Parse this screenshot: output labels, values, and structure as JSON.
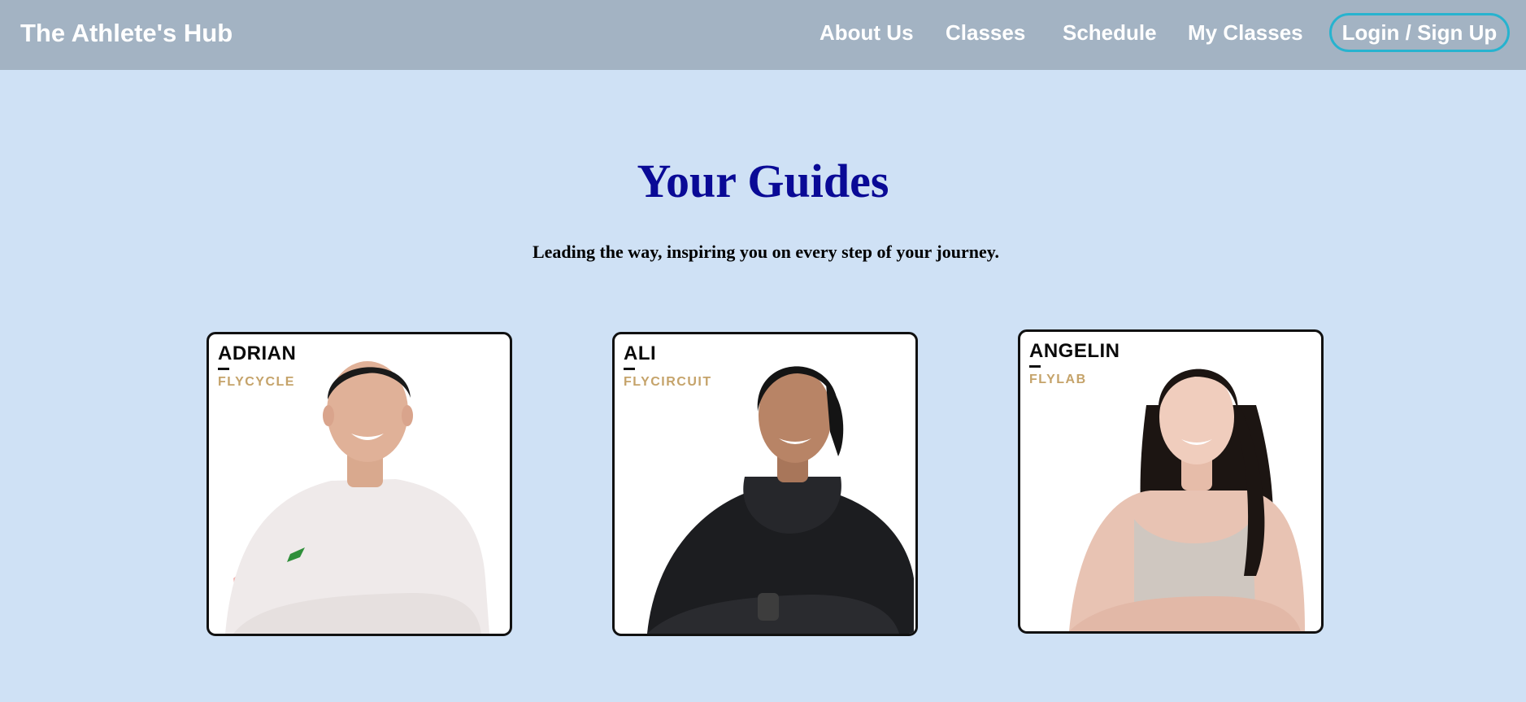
{
  "navbar": {
    "brand": "The Athlete's Hub",
    "links": [
      {
        "label": "About Us"
      },
      {
        "label": "Classes"
      },
      {
        "label": "Schedule"
      },
      {
        "label": "My Classes"
      }
    ],
    "login_label": "Login / Sign Up"
  },
  "hero": {
    "title": "Your Guides",
    "subtitle": "Leading the way, inspiring you on every step of your journey."
  },
  "guides": [
    {
      "name": "ADRIAN",
      "class_name": "FLYCYCLE"
    },
    {
      "name": "ALI",
      "class_name": "FLYCIRCUIT"
    },
    {
      "name": "ANGELIN",
      "class_name": "FLYLAB"
    }
  ],
  "colors": {
    "page_background": "#cfe1f5",
    "navbar_background": "#a3b3c3",
    "login_border": "#27b3cf",
    "heading": "#0a0a96",
    "class_label": "#c5a36a"
  }
}
